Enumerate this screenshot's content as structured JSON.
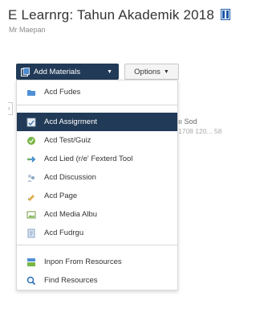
{
  "page": {
    "title": "E Learnrg: Tahun Akademik 2018",
    "subtitle": "Mr Maepan"
  },
  "toolbar": {
    "add_materials_label": "Add Materials",
    "options_label": "Options"
  },
  "background": {
    "text1": "ıı Sod",
    "text2": "1708 120... 58"
  },
  "menu": {
    "items": [
      {
        "label": "Acd Fudes",
        "icon": "folder-icon"
      },
      {
        "label": "Acd Assigrment",
        "icon": "assignment-icon",
        "active": true
      },
      {
        "label": "Acd Test/Guiz",
        "icon": "quiz-icon"
      },
      {
        "label": "Acd Lied (r/e' Fexterd Tool",
        "icon": "link-icon"
      },
      {
        "label": "Acd Discussion",
        "icon": "discussion-icon"
      },
      {
        "label": "Acd Page",
        "icon": "page-icon"
      },
      {
        "label": "Acd Media Albu",
        "icon": "media-album-icon"
      },
      {
        "label": "Acd Fudrgu",
        "icon": "file-icon"
      },
      {
        "label": "Inpon From Resources",
        "icon": "import-icon"
      },
      {
        "label": "Find Resources",
        "icon": "find-icon"
      }
    ]
  },
  "colors": {
    "accent": "#213a57",
    "menu_border": "#d8d8d8"
  }
}
